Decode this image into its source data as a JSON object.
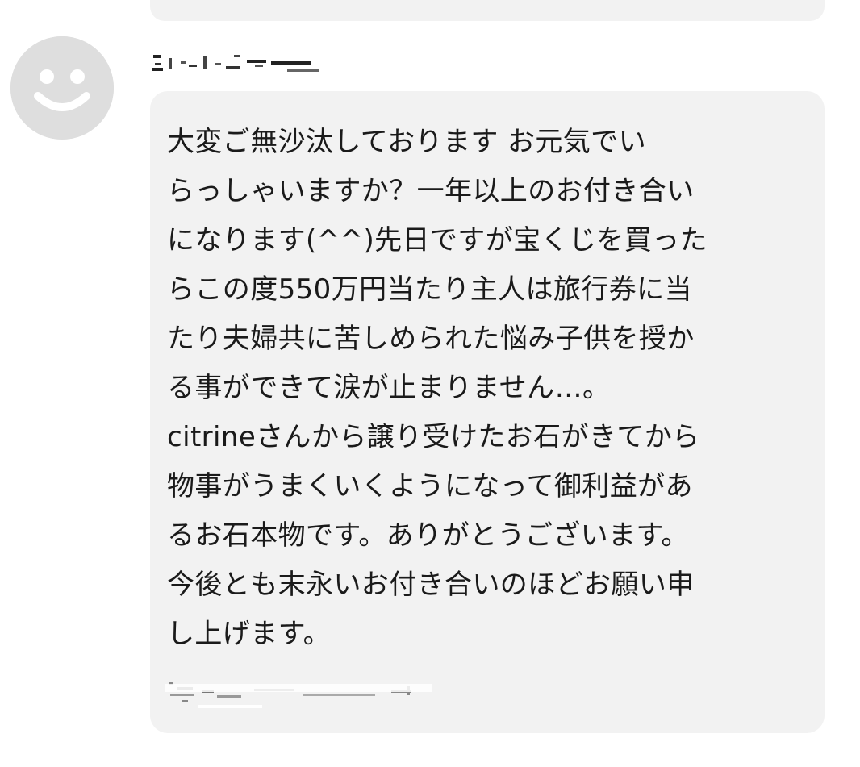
{
  "chat": {
    "incoming_message": {
      "avatar_icon": "default-smiley-avatar-icon",
      "sender_name_redacted": true,
      "signature_redacted": true,
      "text_lines": [
        "大変ご無沙汰しております お元気でい",
        "らっしゃいますか？一年以上のお付き合い",
        "になります(^^)先日ですが宝くじを買った",
        "らこの度550万円当たり主人は旅行券に当",
        "たり夫婦共に苦しめられた悩み子供を授か",
        "る事ができて涙が止まりません…。",
        "citrineさんから譲り受けたお石がきてから",
        "物事がうまくいくようになって御利益があ",
        "るお石本物です。ありがとうございます。",
        "今後とも末永いお付き合いのほどお願い申",
        "し上げます。"
      ]
    },
    "colors": {
      "bubble_background": "#f2f2f2",
      "avatar_background": "#dedede",
      "avatar_face": "#ffffff",
      "text": "#1a1a1a"
    }
  }
}
